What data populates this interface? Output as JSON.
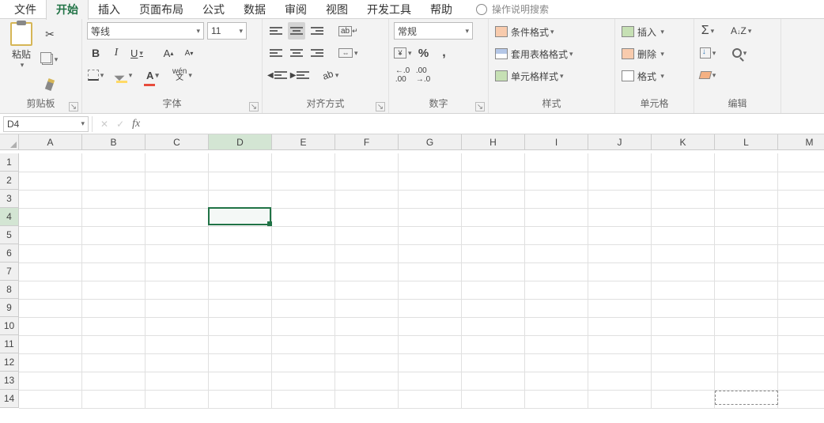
{
  "tabs": {
    "file": "文件",
    "home": "开始",
    "insert": "插入",
    "layout": "页面布局",
    "formulas": "公式",
    "data": "数据",
    "review": "审阅",
    "view": "视图",
    "dev": "开发工具",
    "help": "帮助",
    "tellme": "操作说明搜索"
  },
  "clipboard": {
    "paste": "粘贴",
    "label": "剪贴板"
  },
  "font": {
    "name": "等线",
    "size": "11",
    "bold": "B",
    "italic": "I",
    "underline": "U",
    "grow": "A",
    "shrink": "A",
    "color_letter": "A",
    "pinyin_top": "wén",
    "pinyin_bot": "文",
    "label": "字体"
  },
  "align": {
    "wrap": "ab",
    "label": "对齐方式"
  },
  "number": {
    "format": "常规",
    "pct": "%",
    "comma": ",",
    "dec_inc": ".0\n.00",
    "dec_dec": ".00\n.0",
    "label": "数字"
  },
  "styles": {
    "cond": "条件格式",
    "table": "套用表格格式",
    "cell": "单元格样式",
    "label": "样式"
  },
  "cells": {
    "insert": "插入",
    "delete": "删除",
    "format": "格式",
    "label": "单元格"
  },
  "editing": {
    "sigma": "Σ",
    "label": "编辑"
  },
  "namebox": "D4",
  "fx": "fx",
  "columns": [
    "A",
    "B",
    "C",
    "D",
    "E",
    "F",
    "G",
    "H",
    "I",
    "J",
    "K",
    "L",
    "M"
  ],
  "rows": [
    "1",
    "2",
    "3",
    "4",
    "5",
    "6",
    "7",
    "8",
    "9",
    "10",
    "11",
    "12",
    "13",
    "14"
  ],
  "active_cell": {
    "col": 3,
    "row": 3
  }
}
